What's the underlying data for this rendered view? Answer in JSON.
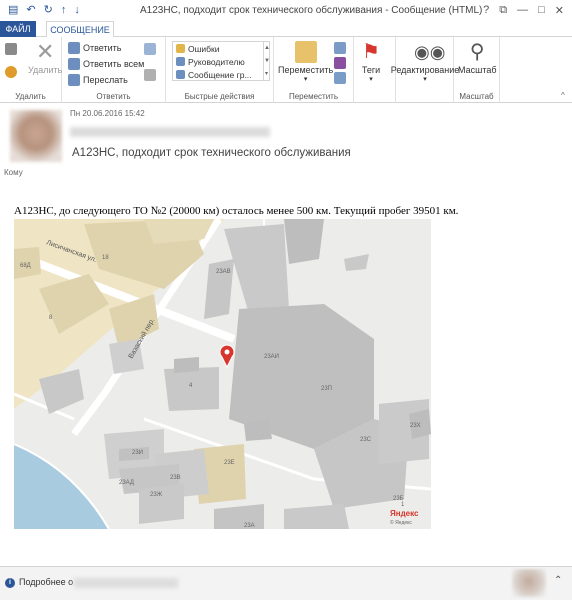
{
  "window": {
    "title": "A123HC, подходит срок технического обслуживания - Сообщение (HTML) (Тольк...",
    "quick_access": [
      "save-icon",
      "undo-icon",
      "redo-icon",
      "up-icon",
      "down-icon"
    ],
    "controls": [
      "?",
      "⧉",
      "—",
      "□",
      "✕"
    ]
  },
  "tabs": {
    "file": "ФАЙЛ",
    "message": "СООБЩЕНИЕ"
  },
  "ribbon": {
    "delete_group": {
      "label": "Удалить",
      "delete_button": "Удалить"
    },
    "respond_group": {
      "label": "Ответить",
      "reply": "Ответить",
      "reply_all": "Ответить всем",
      "forward": "Переслать"
    },
    "quick_steps": {
      "label": "Быстрые действия",
      "items": [
        "Ошибки",
        "Руководителю",
        "Сообщение гр..."
      ]
    },
    "move_group": {
      "label": "Переместить",
      "move": "Переместить"
    },
    "tags": {
      "label": "Теги"
    },
    "editing": {
      "label": "Редактирование"
    },
    "zoom_group": {
      "label": "Масштаб",
      "zoom": "Масштаб"
    }
  },
  "message": {
    "date": "Пн 20.06.2016 15:42",
    "subject": "A123HC, подходит срок технического обслуживания",
    "to_label": "Кому",
    "body": "A123HC, до следующего ТО №2 (20000 км) осталось менее 500 км. Текущий пробег 39501 км."
  },
  "map": {
    "street_1": "Лисичанская ул.",
    "street_2": "Вазаский пер.",
    "logo": "Яндекс",
    "logo_sub": "© Яндекс",
    "buildings": [
      "68Д",
      "18",
      "8",
      "4",
      "23АВ",
      "23АИ",
      "23П",
      "23С",
      "23Х",
      "23И",
      "23В",
      "23Е",
      "23АД",
      "23Ж",
      "23Б",
      "23А",
      "1"
    ]
  },
  "footer": {
    "more_label": "Подробнее о"
  }
}
